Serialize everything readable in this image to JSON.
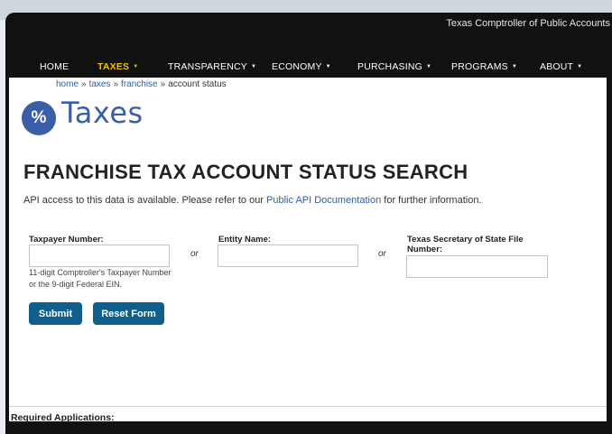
{
  "site": {
    "agency_link": "Texas Comptroller of Public Accounts"
  },
  "nav": {
    "items": [
      {
        "label": "HOME",
        "caret": ""
      },
      {
        "label": "TAXES",
        "caret": "▼"
      },
      {
        "label": "TRANSPARENCY",
        "caret": "▼"
      },
      {
        "label": "ECONOMY",
        "caret": "▼"
      },
      {
        "label": "PURCHASING",
        "caret": "▼"
      },
      {
        "label": "PROGRAMS",
        "caret": "▼"
      },
      {
        "label": "ABOUT",
        "caret": "▼"
      }
    ]
  },
  "breadcrumb": {
    "home": "home",
    "taxes": "taxes",
    "franchise": "franchise",
    "current": "account status",
    "sep": "»"
  },
  "section": {
    "icon_text": "%",
    "title": "Taxes"
  },
  "page": {
    "title": "FRANCHISE TAX ACCOUNT STATUS SEARCH",
    "intro_prefix": "API access to this data is available. Please refer to our ",
    "intro_link": "Public API Documentation",
    "intro_suffix": " for further information."
  },
  "form": {
    "taxpayer_label": "Taxpayer Number:",
    "taxpayer_value": "",
    "taxpayer_hint": "11-digit Comptroller's Taxpayer Number or the 9-digit Federal EIN.",
    "or_text": "or",
    "entity_label": "Entity Name:",
    "entity_value": "",
    "sos_label": "Texas Secretary of State File Number:",
    "sos_value": "",
    "submit": "Submit",
    "reset": "Reset Form"
  },
  "footer": {
    "required_apps": "Required Applications:"
  },
  "colors": {
    "nav_bg": "#111111",
    "accent": "#f2c200",
    "brand_blue": "#3a5ea8",
    "button": "#0f5f8d"
  }
}
